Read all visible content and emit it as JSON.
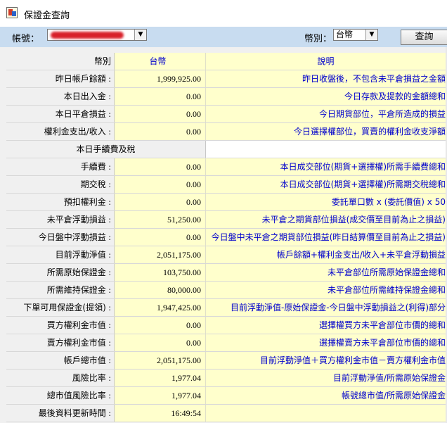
{
  "window": {
    "title": "保證金查詢",
    "icon": "app-icon"
  },
  "toolbar": {
    "account_label": "帳號：",
    "account_value": "",
    "currency_label": "幣別：",
    "currency_value": "台幣",
    "query_button": "查詢"
  },
  "table": {
    "header": {
      "label": "幣別",
      "value": "台幣",
      "desc": "說明"
    },
    "section_title": "本日手續費及稅",
    "rows": [
      {
        "label": "昨日帳戶餘額",
        "value": "1,999,925.00",
        "desc": "昨日收盤後，不包含未平倉損益之金額"
      },
      {
        "label": "本日出入金",
        "value": "0.00",
        "desc": "今日存款及提款的金額總和"
      },
      {
        "label": "本日平倉損益",
        "value": "0.00",
        "desc": "今日期貨部位，平倉所造成的損益"
      },
      {
        "label": "權利金支出/收入",
        "value": "0.00",
        "desc": "今日選擇權部位，買賣的權利金收支淨額"
      },
      {
        "label": "手續費",
        "value": "0.00",
        "desc": "本日成交部位(期貨+選擇權)所需手續費總和"
      },
      {
        "label": "期交稅",
        "value": "0.00",
        "desc": "本日成交部位(期貨+選擇權)所需期交稅總和"
      },
      {
        "label": "預扣權利金",
        "value": "0.00",
        "desc": "委託單口數 x (委託價值) x 50"
      },
      {
        "label": "未平倉浮動損益",
        "value": "51,250.00",
        "desc": "未平倉之期貨部位損益(成交價至目前為止之損益)"
      },
      {
        "label": "今日盤中浮動損益",
        "value": "0.00",
        "desc": "今日盤中未平倉之期貨部位損益(昨日結算價至目前為止之損益)"
      },
      {
        "label": "目前浮動淨值",
        "value": "2,051,175.00",
        "desc": "帳戶餘額+權利金支出/收入+未平倉浮動損益"
      },
      {
        "label": "所需原始保證金",
        "value": "103,750.00",
        "desc": "未平倉部位所需原始保證金總和"
      },
      {
        "label": "所需維持保證金",
        "value": "80,000.00",
        "desc": "未平倉部位所需維持保證金總和"
      },
      {
        "label": "下單可用保證金(提領)",
        "value": "1,947,425.00",
        "desc": "目前浮動淨值-原始保證金-今日盤中浮動損益之(利得)部分"
      },
      {
        "label": "買方權利金市值",
        "value": "0.00",
        "desc": "選擇權買方未平倉部位市價的總和"
      },
      {
        "label": "賣方權利金市值",
        "value": "0.00",
        "desc": "選擇權賣方未平倉部位市價的總和"
      },
      {
        "label": "帳戶總市值",
        "value": "2,051,175.00",
        "desc": "目前浮動淨值＋買方權利金市值－賣方權利金市值"
      },
      {
        "label": "風險比率",
        "value": "1,977.04",
        "desc": "目前浮動淨值/所需原始保證金"
      },
      {
        "label": "總市值風險比率",
        "value": "1,977.04",
        "desc": "帳號總市值/所需原始保證金"
      },
      {
        "label": "最後資料更新時間",
        "value": "16:49:54",
        "desc": ""
      }
    ]
  }
}
